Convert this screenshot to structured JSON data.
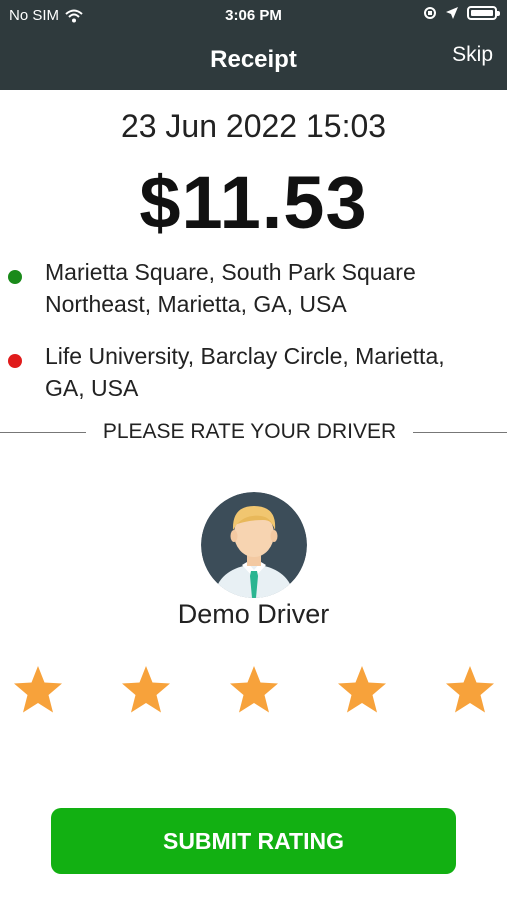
{
  "status_bar": {
    "carrier": "No SIM",
    "time": "3:06 PM"
  },
  "header": {
    "title": "Receipt",
    "skip_label": "Skip"
  },
  "receipt": {
    "datetime": "23 Jun 2022 15:03",
    "amount": "$11.53",
    "pickup": "Marietta Square, South Park Square Northeast, Marietta, GA, USA",
    "dropoff": "Life University, Barclay Circle, Marietta, GA, USA"
  },
  "rating": {
    "prompt": "PLEASE RATE YOUR DRIVER",
    "driver_name": "Demo Driver",
    "stars_selected": 5,
    "stars_total": 5,
    "submit_label": "SUBMIT RATING"
  },
  "colors": {
    "header_bg": "#2f3a3d",
    "pickup_dot": "#1a8a1a",
    "dropoff_dot": "#e01b1b",
    "star": "#f7a23b",
    "submit_bg": "#12b012"
  },
  "icons": {
    "status": [
      "wifi-icon",
      "orientation-lock-icon",
      "location-arrow-icon",
      "battery-icon"
    ],
    "rating": "star-icon",
    "avatar": "driver-avatar-icon"
  }
}
